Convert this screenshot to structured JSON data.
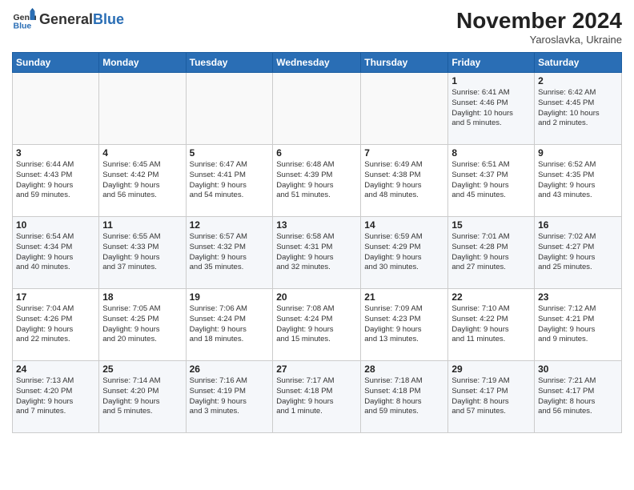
{
  "header": {
    "logo_general": "General",
    "logo_blue": "Blue",
    "month_title": "November 2024",
    "subtitle": "Yaroslavka, Ukraine"
  },
  "weekdays": [
    "Sunday",
    "Monday",
    "Tuesday",
    "Wednesday",
    "Thursday",
    "Friday",
    "Saturday"
  ],
  "weeks": [
    [
      {
        "day": "",
        "info": ""
      },
      {
        "day": "",
        "info": ""
      },
      {
        "day": "",
        "info": ""
      },
      {
        "day": "",
        "info": ""
      },
      {
        "day": "",
        "info": ""
      },
      {
        "day": "1",
        "info": "Sunrise: 6:41 AM\nSunset: 4:46 PM\nDaylight: 10 hours\nand 5 minutes."
      },
      {
        "day": "2",
        "info": "Sunrise: 6:42 AM\nSunset: 4:45 PM\nDaylight: 10 hours\nand 2 minutes."
      }
    ],
    [
      {
        "day": "3",
        "info": "Sunrise: 6:44 AM\nSunset: 4:43 PM\nDaylight: 9 hours\nand 59 minutes."
      },
      {
        "day": "4",
        "info": "Sunrise: 6:45 AM\nSunset: 4:42 PM\nDaylight: 9 hours\nand 56 minutes."
      },
      {
        "day": "5",
        "info": "Sunrise: 6:47 AM\nSunset: 4:41 PM\nDaylight: 9 hours\nand 54 minutes."
      },
      {
        "day": "6",
        "info": "Sunrise: 6:48 AM\nSunset: 4:39 PM\nDaylight: 9 hours\nand 51 minutes."
      },
      {
        "day": "7",
        "info": "Sunrise: 6:49 AM\nSunset: 4:38 PM\nDaylight: 9 hours\nand 48 minutes."
      },
      {
        "day": "8",
        "info": "Sunrise: 6:51 AM\nSunset: 4:37 PM\nDaylight: 9 hours\nand 45 minutes."
      },
      {
        "day": "9",
        "info": "Sunrise: 6:52 AM\nSunset: 4:35 PM\nDaylight: 9 hours\nand 43 minutes."
      }
    ],
    [
      {
        "day": "10",
        "info": "Sunrise: 6:54 AM\nSunset: 4:34 PM\nDaylight: 9 hours\nand 40 minutes."
      },
      {
        "day": "11",
        "info": "Sunrise: 6:55 AM\nSunset: 4:33 PM\nDaylight: 9 hours\nand 37 minutes."
      },
      {
        "day": "12",
        "info": "Sunrise: 6:57 AM\nSunset: 4:32 PM\nDaylight: 9 hours\nand 35 minutes."
      },
      {
        "day": "13",
        "info": "Sunrise: 6:58 AM\nSunset: 4:31 PM\nDaylight: 9 hours\nand 32 minutes."
      },
      {
        "day": "14",
        "info": "Sunrise: 6:59 AM\nSunset: 4:29 PM\nDaylight: 9 hours\nand 30 minutes."
      },
      {
        "day": "15",
        "info": "Sunrise: 7:01 AM\nSunset: 4:28 PM\nDaylight: 9 hours\nand 27 minutes."
      },
      {
        "day": "16",
        "info": "Sunrise: 7:02 AM\nSunset: 4:27 PM\nDaylight: 9 hours\nand 25 minutes."
      }
    ],
    [
      {
        "day": "17",
        "info": "Sunrise: 7:04 AM\nSunset: 4:26 PM\nDaylight: 9 hours\nand 22 minutes."
      },
      {
        "day": "18",
        "info": "Sunrise: 7:05 AM\nSunset: 4:25 PM\nDaylight: 9 hours\nand 20 minutes."
      },
      {
        "day": "19",
        "info": "Sunrise: 7:06 AM\nSunset: 4:24 PM\nDaylight: 9 hours\nand 18 minutes."
      },
      {
        "day": "20",
        "info": "Sunrise: 7:08 AM\nSunset: 4:24 PM\nDaylight: 9 hours\nand 15 minutes."
      },
      {
        "day": "21",
        "info": "Sunrise: 7:09 AM\nSunset: 4:23 PM\nDaylight: 9 hours\nand 13 minutes."
      },
      {
        "day": "22",
        "info": "Sunrise: 7:10 AM\nSunset: 4:22 PM\nDaylight: 9 hours\nand 11 minutes."
      },
      {
        "day": "23",
        "info": "Sunrise: 7:12 AM\nSunset: 4:21 PM\nDaylight: 9 hours\nand 9 minutes."
      }
    ],
    [
      {
        "day": "24",
        "info": "Sunrise: 7:13 AM\nSunset: 4:20 PM\nDaylight: 9 hours\nand 7 minutes."
      },
      {
        "day": "25",
        "info": "Sunrise: 7:14 AM\nSunset: 4:20 PM\nDaylight: 9 hours\nand 5 minutes."
      },
      {
        "day": "26",
        "info": "Sunrise: 7:16 AM\nSunset: 4:19 PM\nDaylight: 9 hours\nand 3 minutes."
      },
      {
        "day": "27",
        "info": "Sunrise: 7:17 AM\nSunset: 4:18 PM\nDaylight: 9 hours\nand 1 minute."
      },
      {
        "day": "28",
        "info": "Sunrise: 7:18 AM\nSunset: 4:18 PM\nDaylight: 8 hours\nand 59 minutes."
      },
      {
        "day": "29",
        "info": "Sunrise: 7:19 AM\nSunset: 4:17 PM\nDaylight: 8 hours\nand 57 minutes."
      },
      {
        "day": "30",
        "info": "Sunrise: 7:21 AM\nSunset: 4:17 PM\nDaylight: 8 hours\nand 56 minutes."
      }
    ]
  ]
}
